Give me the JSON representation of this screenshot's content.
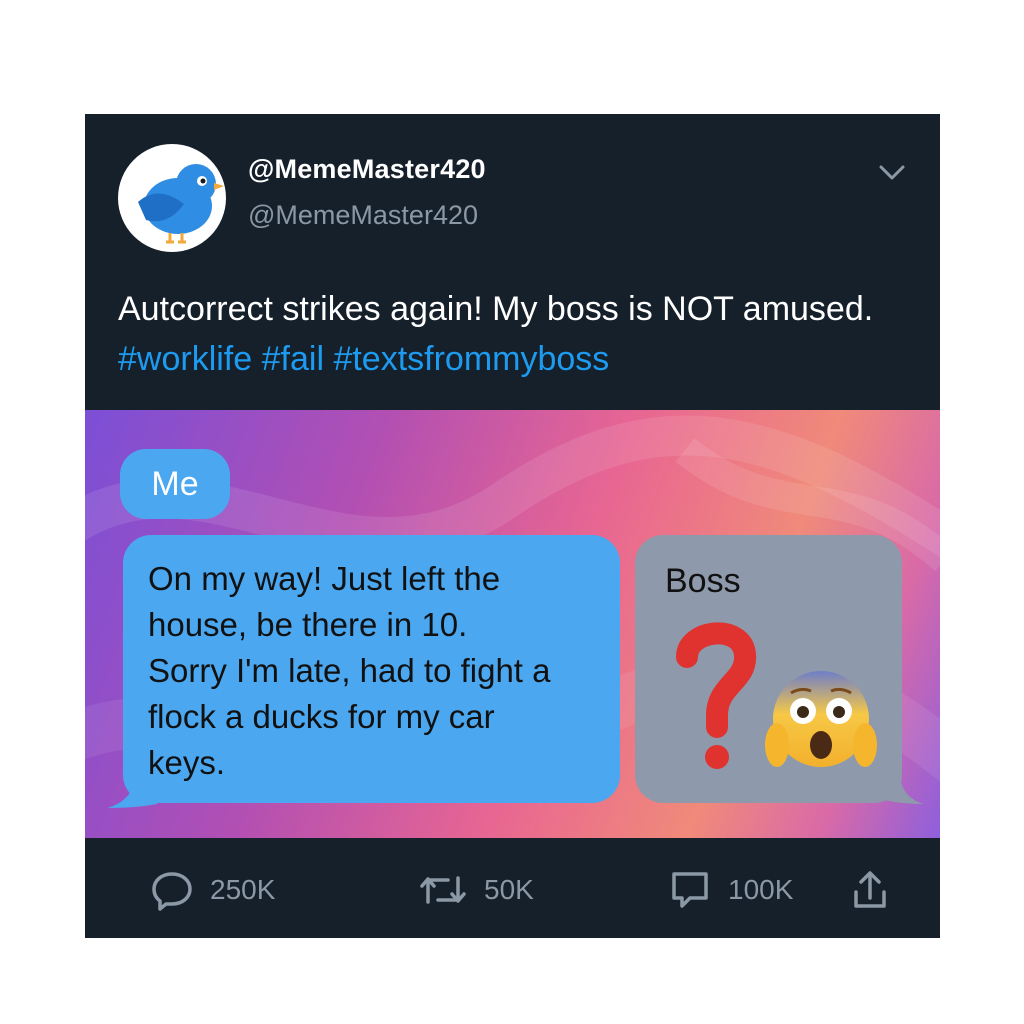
{
  "tweet": {
    "display_name": "@MemeMaster420",
    "handle": "@MemeMaster420",
    "text": "Autcorrect strikes again! My boss is NOT amused.",
    "hashtags": [
      "#worklife",
      "#fail",
      "#textsfrommyboss"
    ]
  },
  "media": {
    "me_label": "Me",
    "me_message_lines": [
      "On my way! Just left the",
      "house, be there in 10.",
      "Sorry I'm late, had to fight a",
      "flock a ducks for my car",
      "keys."
    ],
    "boss_label": "Boss",
    "boss_reaction_icons": [
      "red-question-mark-icon",
      "face-screaming-in-fear-emoji"
    ]
  },
  "actions": {
    "replies": "250K",
    "retweets": "50K",
    "quotes": "100K"
  },
  "colors": {
    "card_background": "#15202b",
    "hashtag": "#1d9bf0",
    "me_bubble": "#4aa7f0",
    "boss_bubble": "#8e9aab",
    "muted_text": "#8b98a5"
  }
}
